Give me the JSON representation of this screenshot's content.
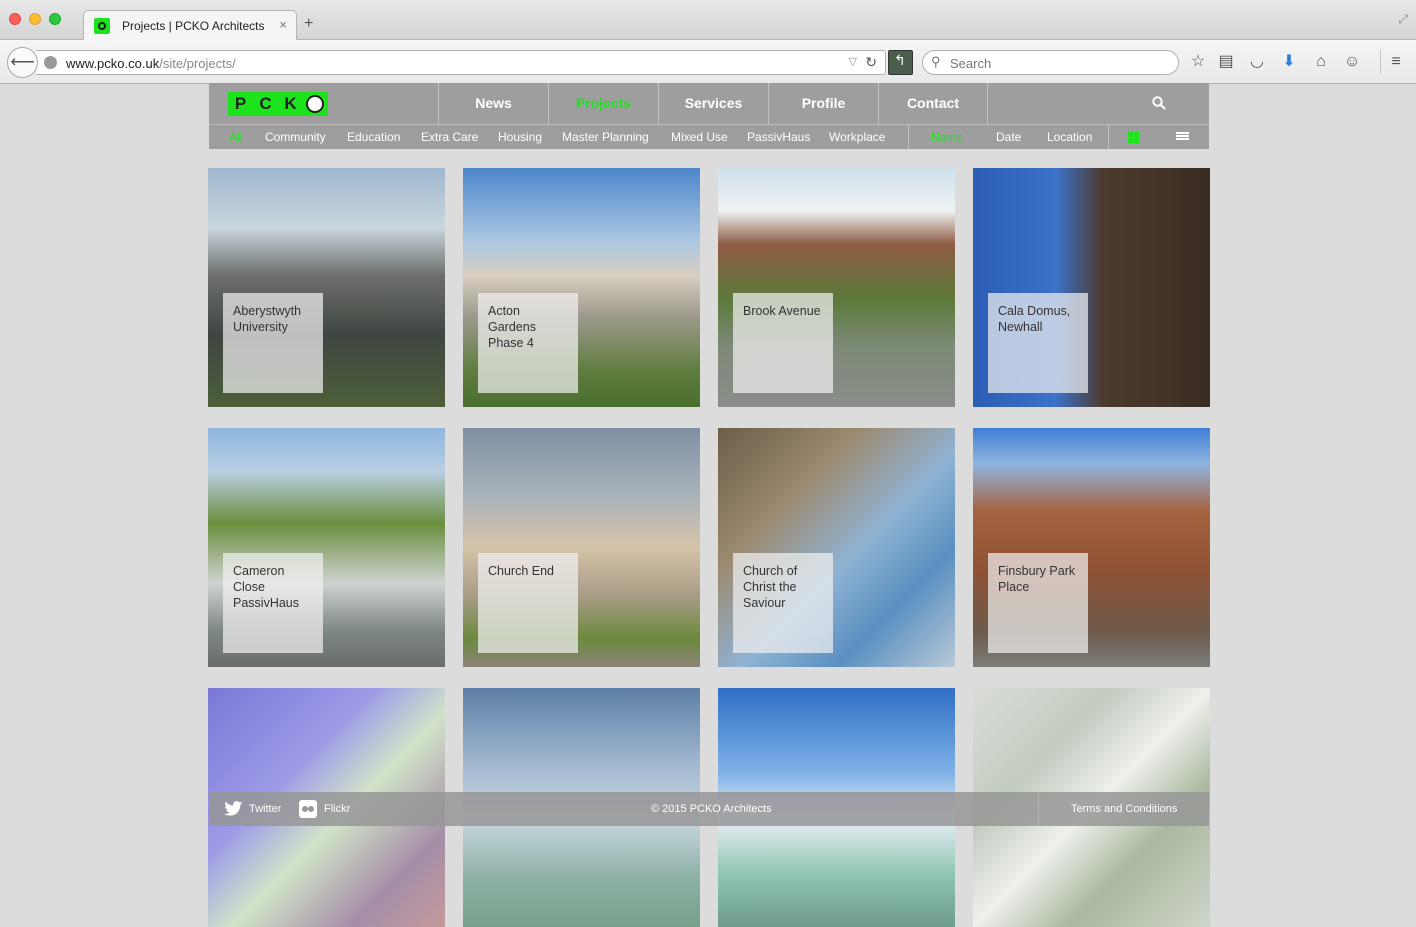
{
  "browser": {
    "tab_title": "Projects | PCKO Architects",
    "tab_close": "×",
    "new_tab": "+",
    "url_domain": "www.pcko.co.uk",
    "url_path": "/site/projects/",
    "search_placeholder": "Search"
  },
  "site": {
    "logo_letters": [
      "P",
      "C",
      "K"
    ],
    "nav": [
      {
        "label": "News",
        "active": false
      },
      {
        "label": "Projects",
        "active": true
      },
      {
        "label": "Services",
        "active": false
      },
      {
        "label": "Profile",
        "active": false
      },
      {
        "label": "Contact",
        "active": false
      }
    ],
    "filters": [
      {
        "label": "All",
        "active": true
      },
      {
        "label": "Community",
        "active": false
      },
      {
        "label": "Education",
        "active": false
      },
      {
        "label": "Extra Care",
        "active": false
      },
      {
        "label": "Housing",
        "active": false
      },
      {
        "label": "Master Planning",
        "active": false
      },
      {
        "label": "Mixed Use",
        "active": false
      },
      {
        "label": "PassivHaus",
        "active": false
      },
      {
        "label": "Workplace",
        "active": false
      }
    ],
    "sort": [
      {
        "label": "Name",
        "active": true
      },
      {
        "label": "Date",
        "active": false
      },
      {
        "label": "Location",
        "active": false
      }
    ],
    "accent_color": "#1ce31c",
    "header_color": "#9e9e9e"
  },
  "projects": [
    {
      "title": "Aberystwyth\nUniversity"
    },
    {
      "title": "Acton\nGardens\nPhase 4"
    },
    {
      "title": "Brook Avenue"
    },
    {
      "title": "Cala Domus,\nNewhall"
    },
    {
      "title": "Cameron\nClose\nPassivHaus"
    },
    {
      "title": "Church End"
    },
    {
      "title": "Church of\nChrist the\nSaviour"
    },
    {
      "title": "Finsbury Park\nPlace"
    },
    {
      "title": ""
    },
    {
      "title": ""
    },
    {
      "title": ""
    },
    {
      "title": ""
    }
  ],
  "footer": {
    "twitter": "Twitter",
    "flickr": "Flickr",
    "copyright": "© 2015 PCKO Architects",
    "terms": "Terms and Conditions"
  }
}
